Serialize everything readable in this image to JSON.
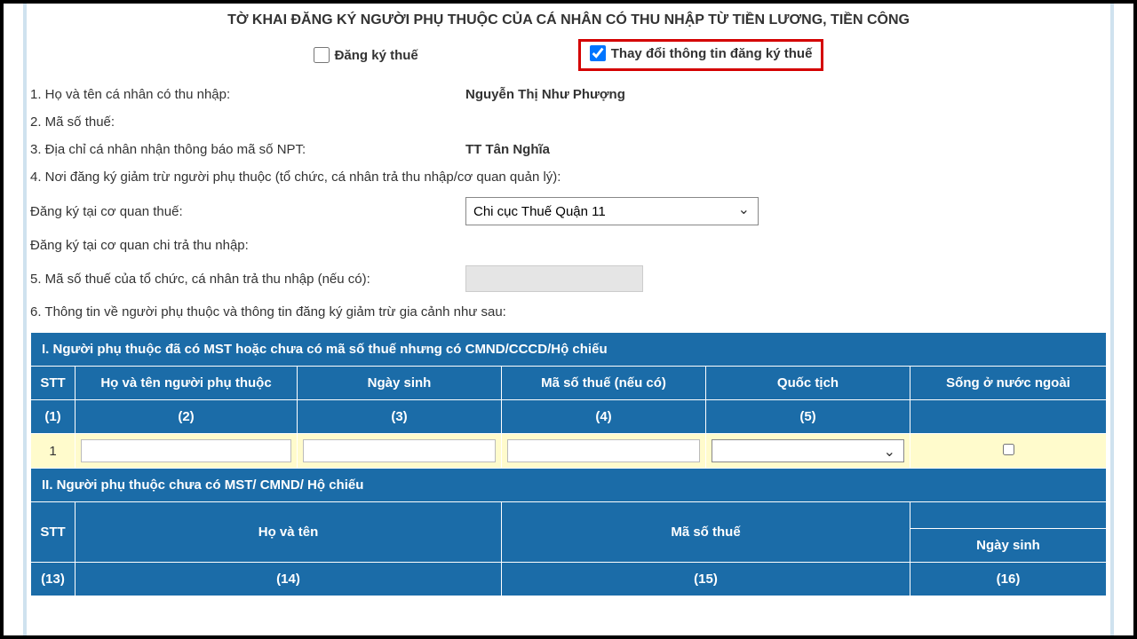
{
  "title": "TỜ KHAI ĐĂNG KÝ NGƯỜI PHỤ THUỘC CỦA CÁ NHÂN CÓ THU NHẬP TỪ TIỀN LƯƠNG, TIỀN CÔNG",
  "checkboxes": {
    "register_label": "Đăng ký thuế",
    "change_label": "Thay đổi thông tin đăng ký thuế"
  },
  "fields": {
    "f1_label": "1. Họ và tên cá nhân có thu nhập:",
    "f1_value": "Nguyễn Thị Như Phượng",
    "f2_label": "2. Mã số thuế:",
    "f3_label": "3. Địa chỉ cá nhân nhận thông báo mã số NPT:",
    "f3_value": "TT Tân Nghĩa",
    "f4_label": "4. Nơi đăng ký giảm trừ người phụ thuộc (tổ chức, cá nhân trả thu nhập/cơ quan quản lý):",
    "reg_tax_label": "Đăng ký tại cơ quan thuế:",
    "reg_tax_value": "Chi cục Thuế Quận 11",
    "reg_pay_label": "Đăng ký tại cơ quan chi trả thu nhập:",
    "f5_label": "5. Mã số thuế của tổ chức, cá nhân trả thu nhập (nếu có):",
    "f6_label": "6. Thông tin về người phụ thuộc và thông tin đăng ký giảm trừ gia cảnh như sau:"
  },
  "table1": {
    "section_title": "I. Người phụ thuộc đã có MST hoặc chưa có mã số thuế nhưng có CMND/CCCD/Hộ chiếu",
    "cols": {
      "c1": "STT",
      "c2": "Họ và tên người phụ thuộc",
      "c3": "Ngày sinh",
      "c4": "Mã số thuế (nếu có)",
      "c5": "Quốc tịch",
      "c6": "Sống ở nước ngoài"
    },
    "nums": {
      "n1": "(1)",
      "n2": "(2)",
      "n3": "(3)",
      "n4": "(4)",
      "n5": "(5)"
    },
    "row1_stt": "1"
  },
  "table2": {
    "section_title": "II. Người phụ thuộc chưa có MST/ CMND/ Hộ chiếu",
    "cols": {
      "c1": "STT",
      "c2": "Họ và tên",
      "c3": "Mã số thuế",
      "c4": "Ngày sinh"
    },
    "nums": {
      "n1": "(13)",
      "n2": "(14)",
      "n3": "(15)",
      "n4": "(16)"
    }
  }
}
